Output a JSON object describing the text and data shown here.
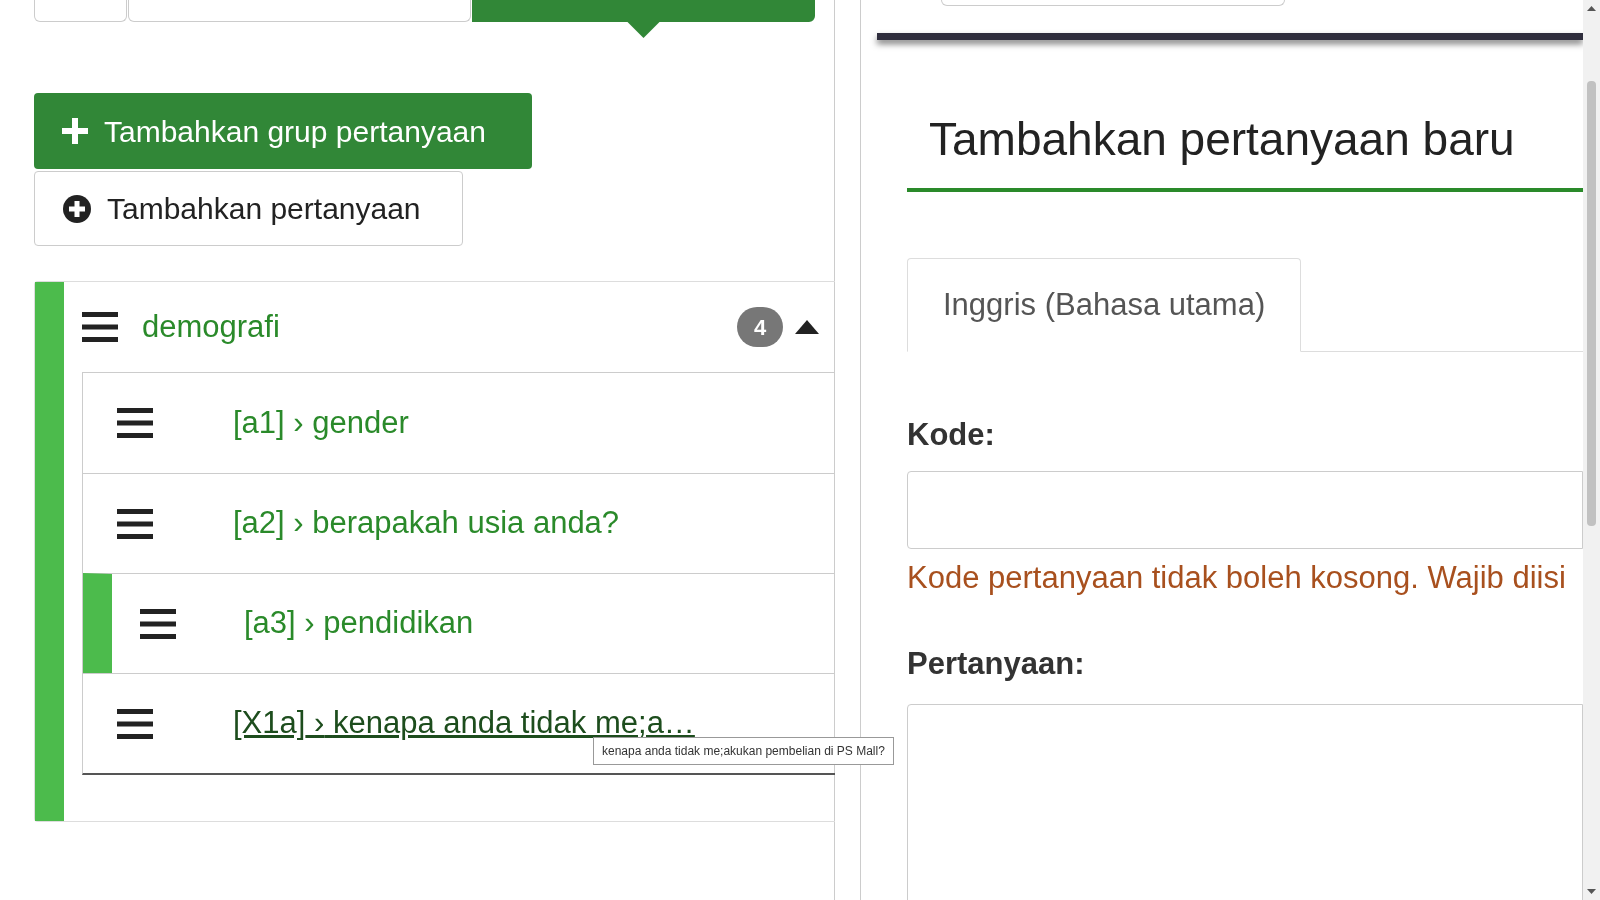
{
  "top_tabs": [
    {
      "selected": false
    },
    {
      "selected": false
    },
    {
      "selected": true
    }
  ],
  "add_group_button": "Tambahkan grup pertanyaan",
  "add_question_button": "Tambahkan pertanyaan",
  "group": {
    "title": "demografi",
    "count": "4",
    "expanded": true,
    "questions": [
      {
        "code": "[a1]",
        "sep": "›",
        "title": "gender",
        "selected": false,
        "hovered": false
      },
      {
        "code": "[a2]",
        "sep": "›",
        "title": "berapakah usia anda?",
        "selected": false,
        "hovered": false
      },
      {
        "code": "[a3]",
        "sep": "›",
        "title": "pendidikan",
        "selected": true,
        "hovered": false
      },
      {
        "code": "[X1a]",
        "sep": "›",
        "title": "kenapa anda tidak me;a…",
        "selected": false,
        "hovered": true
      }
    ]
  },
  "tooltip": "kenapa anda tidak me;akukan pembelian di PS Mall?",
  "form": {
    "heading": "Tambahkan pertanyaan baru",
    "language_tabs": [
      {
        "label": "Inggris (Bahasa utama)",
        "selected": true
      }
    ],
    "code_label": "Kode:",
    "code_error": "Kode pertanyaan tidak boleh kosong. Wajib diisi",
    "question_label": "Pertanyaan:"
  }
}
